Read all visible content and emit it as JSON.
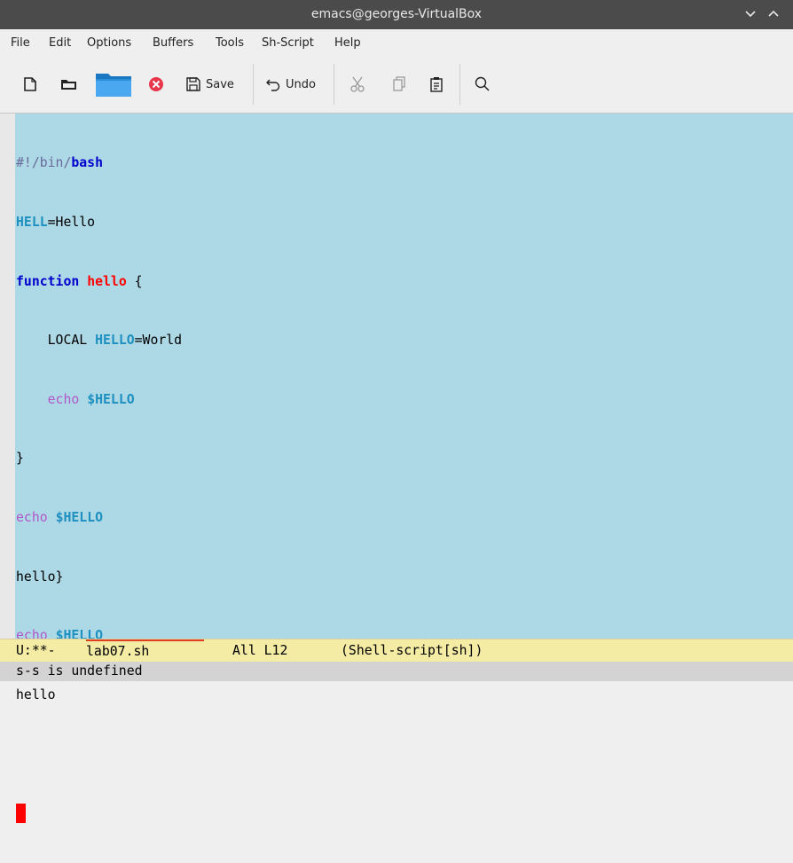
{
  "window": {
    "title": "emacs@georges-VirtualBox"
  },
  "menu": [
    "File",
    "Edit",
    "Options",
    "Buffers",
    "Tools",
    "Sh-Script",
    "Help"
  ],
  "toolbar": {
    "save_label": "Save",
    "undo_label": "Undo",
    "icons": [
      "new-file-icon",
      "open-folder-icon",
      "dired-folder-icon",
      "close-buffer-icon",
      "save-icon",
      "undo-icon",
      "cut-icon",
      "copy-icon",
      "paste-icon",
      "search-icon"
    ]
  },
  "colors": {
    "editor_bg": "#add8e6",
    "keyword": "#0000cd",
    "function_name": "#ff0000",
    "variable": "#1e90c0",
    "builtin": "#b058c8",
    "cursor": "#ff0000",
    "modeline_bg": "#f4eba4"
  },
  "editor": {
    "lines": {
      "l1a": "#!/bin/",
      "l1b": "bash",
      "l2a": "HELL",
      "l2b": "=Hello",
      "l3a": "function",
      "l3b": " ",
      "l3c": "hello",
      "l3d": " {",
      "l4a": "    LOCAL ",
      "l4b": "HELLO",
      "l4c": "=World",
      "l5a": "    ",
      "l5b": "echo",
      "l5c": " ",
      "l5d": "$HELLO",
      "l6": "}",
      "l7a": "echo",
      "l7b": " ",
      "l7c": "$HELLO",
      "l8": "hello}",
      "l9a": "echo",
      "l9b": " ",
      "l9c": "$HELLO",
      "l10": "hello",
      "l11": ""
    },
    "cursor_line": 12
  },
  "modeline": {
    "status": "U:**-",
    "buffer": "lab07.sh",
    "position": "All L12",
    "mode": "(Shell-script[sh])"
  },
  "echo_area": {
    "message": "s-s is undefined"
  }
}
